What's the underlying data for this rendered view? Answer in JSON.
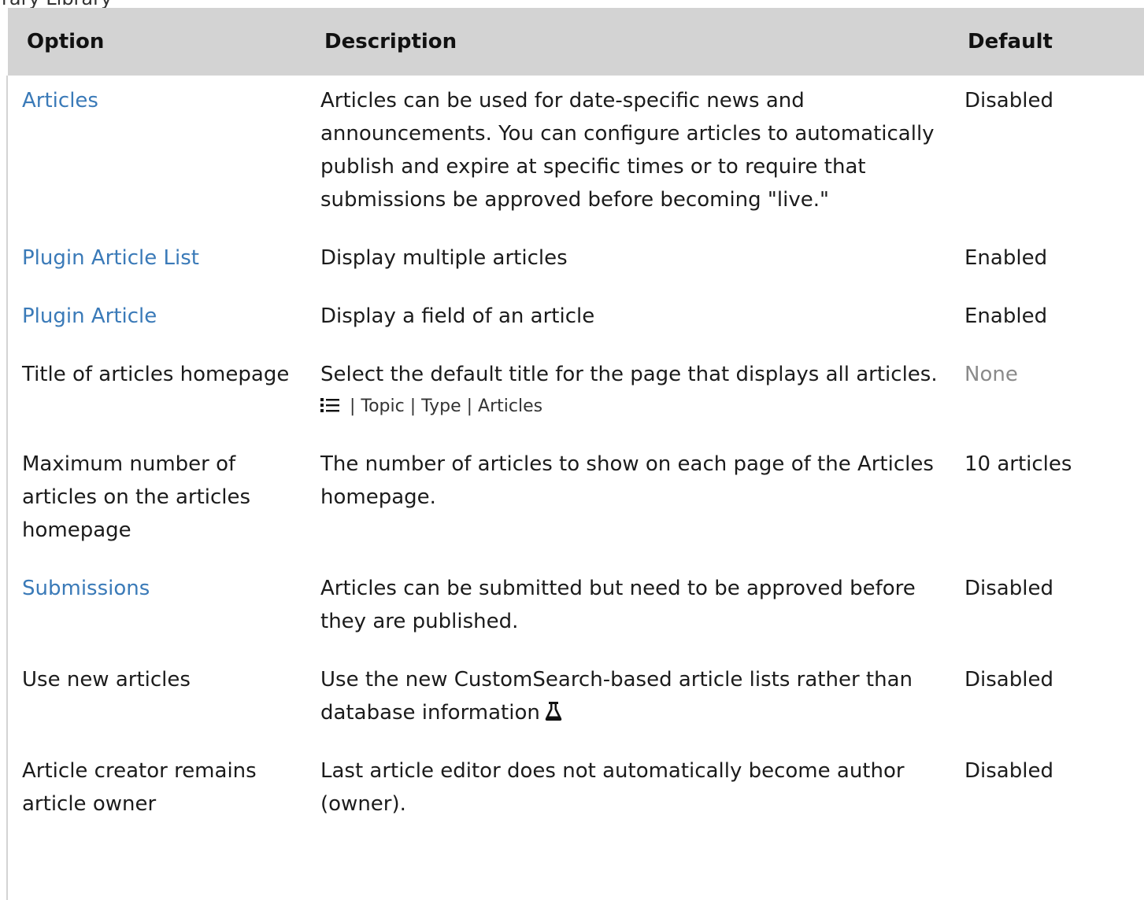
{
  "top_fragment": "rary Library",
  "table": {
    "headers": {
      "option": "Option",
      "description": "Description",
      "default": "Default"
    },
    "rows": [
      {
        "option": "Articles",
        "option_is_link": true,
        "description": "Articles can be used for date-specific news and announcements. You can configure articles to automatically publish and expire at specific times or to require that submissions be approved before becoming \"live.\"",
        "default": "Disabled"
      },
      {
        "option": "Plugin Article List",
        "option_is_link": true,
        "description": "Display multiple articles",
        "default": "Enabled"
      },
      {
        "option": "Plugin Article",
        "option_is_link": true,
        "description": "Display a field of an article",
        "default": "Enabled"
      },
      {
        "option": "Title of articles homepage",
        "option_is_link": false,
        "description": "Select the default title for the page that displays all articles.",
        "meta": {
          "icon": "list-icon",
          "text": " | Topic | Type | Articles"
        },
        "default": "None",
        "default_muted": true
      },
      {
        "option": "Maximum number of articles on the articles homepage",
        "option_is_link": false,
        "description": "The number of articles to show on each page of the Articles homepage.",
        "default": "10 articles"
      },
      {
        "option": "Submissions",
        "option_is_link": true,
        "description": "Articles can be submitted but need to be approved before they are published.",
        "default": "Disabled"
      },
      {
        "option": "Use new articles",
        "option_is_link": false,
        "description": "Use the new CustomSearch-based article lists rather than database information",
        "description_icon": "flask-icon",
        "default": "Disabled"
      },
      {
        "option": "Article creator remains article owner",
        "option_is_link": false,
        "description": "Last article editor does not automatically become author (owner).",
        "default": "Disabled"
      }
    ]
  },
  "colors": {
    "header_bg": "#d3d3d3",
    "link": "#3a7ab8",
    "muted": "#8a8a8a"
  }
}
